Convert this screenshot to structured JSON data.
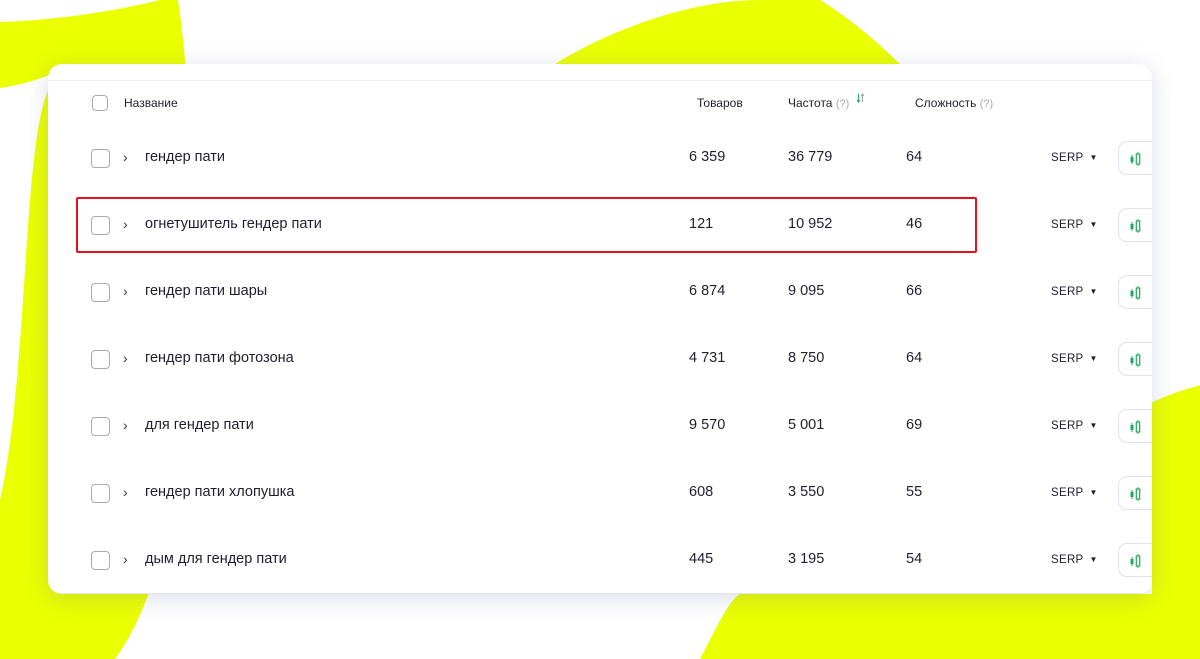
{
  "colors": {
    "accent_yellow": "#eaff00",
    "highlight_red": "#e8101c",
    "candle_green": "#1faa5a"
  },
  "table": {
    "headers": {
      "name": "Название",
      "products": "Товаров",
      "frequency": "Частота",
      "frequency_hint": "(?)",
      "difficulty": "Сложность",
      "difficulty_hint": "(?)"
    },
    "serp_label": "SERP",
    "highlighted_row": 1,
    "rows": [
      {
        "name": "гендер пати",
        "products": "6 359",
        "frequency": "36 779",
        "difficulty": "64"
      },
      {
        "name": "огнетушитель гендер пати",
        "products": "121",
        "frequency": "10 952",
        "difficulty": "46"
      },
      {
        "name": "гендер пати шары",
        "products": "6 874",
        "frequency": "9 095",
        "difficulty": "66"
      },
      {
        "name": "гендер пати фотозона",
        "products": "4 731",
        "frequency": "8 750",
        "difficulty": "64"
      },
      {
        "name": "для гендер пати",
        "products": "9 570",
        "frequency": "5 001",
        "difficulty": "69"
      },
      {
        "name": "гендер пати хлопушка",
        "products": "608",
        "frequency": "3 550",
        "difficulty": "55"
      },
      {
        "name": "дым для гендер пати",
        "products": "445",
        "frequency": "3 195",
        "difficulty": "54"
      }
    ]
  }
}
